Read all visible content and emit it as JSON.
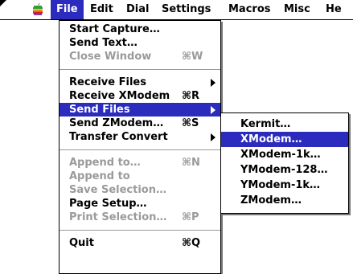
{
  "menubar": {
    "items": [
      {
        "label": "File"
      },
      {
        "label": "Edit"
      },
      {
        "label": "Dial"
      },
      {
        "label": "Settings"
      },
      {
        "label": "Macros"
      },
      {
        "label": "Misc"
      },
      {
        "label": "He"
      }
    ]
  },
  "file_menu": {
    "items": [
      {
        "label": "Start Capture…"
      },
      {
        "label": "Send Text…"
      },
      {
        "label": "Close Window",
        "shortcut": "⌘W"
      },
      {
        "label": "Receive Files"
      },
      {
        "label": "Receive XModem",
        "shortcut": "⌘R"
      },
      {
        "label": "Send Files"
      },
      {
        "label": "Send ZModem…",
        "shortcut": "⌘S"
      },
      {
        "label": "Transfer Convert"
      },
      {
        "label": "Append to…",
        "shortcut": "⌘N"
      },
      {
        "label": "Append to"
      },
      {
        "label": "Save Selection…"
      },
      {
        "label": "Page Setup…"
      },
      {
        "label": "Print Selection…",
        "shortcut": "⌘P"
      },
      {
        "label": "Quit",
        "shortcut": "⌘Q"
      }
    ]
  },
  "send_files_submenu": {
    "items": [
      {
        "label": "Kermit…"
      },
      {
        "label": "XModem…"
      },
      {
        "label": "XModem-1k…"
      },
      {
        "label": "YModem-128…"
      },
      {
        "label": "YModem-1k…"
      },
      {
        "label": "ZModem…"
      }
    ]
  },
  "colors": {
    "highlight": "#2b2bbd",
    "disabled": "#9a9a9a"
  },
  "icons": {
    "apple": "apple-icon",
    "submenu_arrow": "submenu-arrow-icon"
  }
}
